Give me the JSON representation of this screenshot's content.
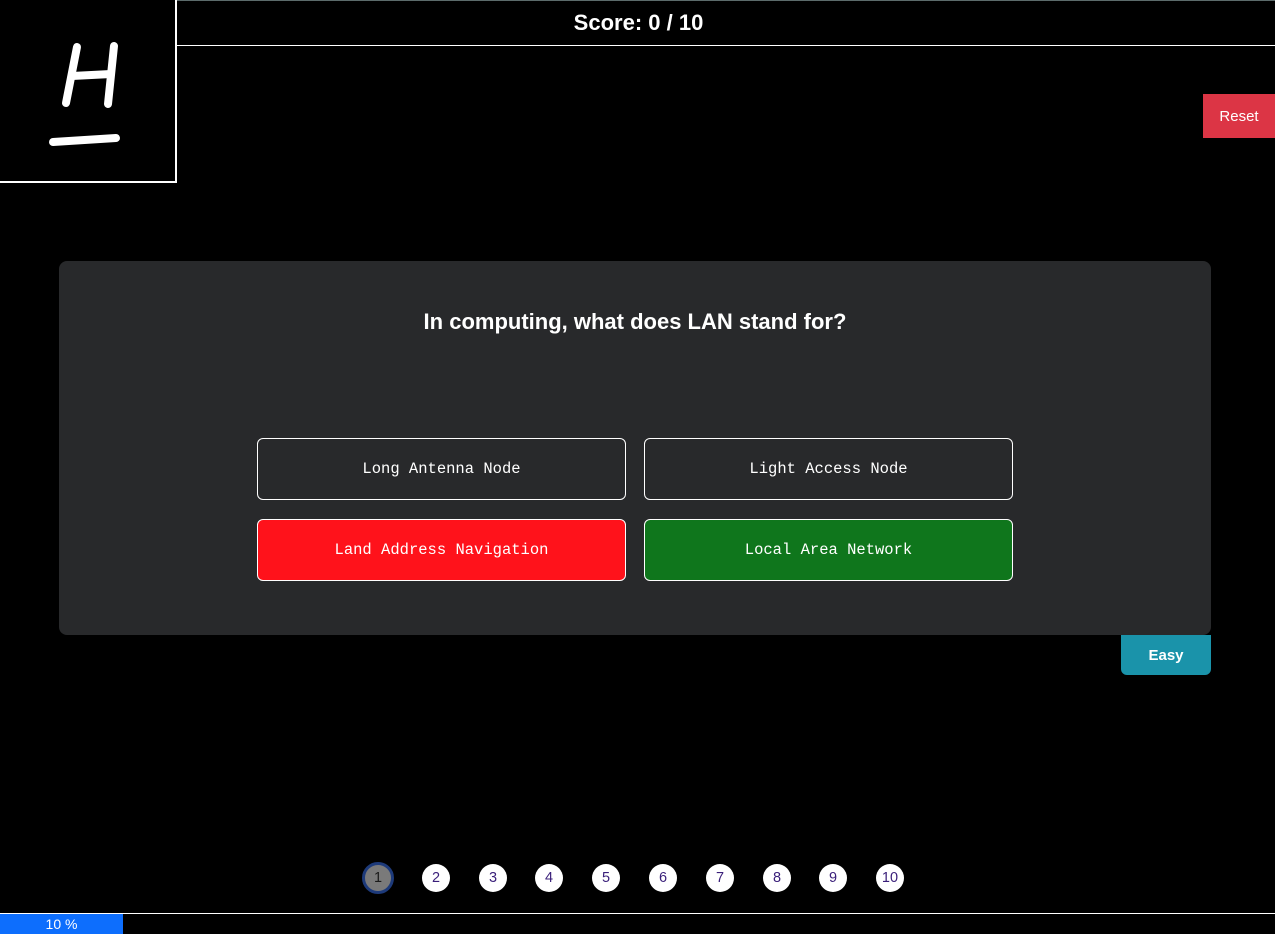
{
  "score": {
    "text": "Score: 0 / 10"
  },
  "logo": {
    "icon": "h-logo-icon"
  },
  "reset": {
    "label": "Reset",
    "color": "#dc3545"
  },
  "question": {
    "text": "In computing, what does LAN stand for?",
    "answers": [
      {
        "label": "Long Antenna Node",
        "state": "neutral",
        "color": "transparent"
      },
      {
        "label": "Light Access Node",
        "state": "neutral",
        "color": "transparent"
      },
      {
        "label": "Land Address Navigation",
        "state": "incorrect",
        "color": "#ff121b"
      },
      {
        "label": "Local Area Network",
        "state": "correct",
        "color": "#0f761c"
      }
    ]
  },
  "difficulty": {
    "label": "Easy",
    "color": "#1a93aa"
  },
  "pagination": {
    "pages": [
      "1",
      "2",
      "3",
      "4",
      "5",
      "6",
      "7",
      "8",
      "9",
      "10"
    ],
    "current": "1"
  },
  "progress": {
    "percent": 10,
    "label": "10 %",
    "color": "#0d6efd"
  }
}
